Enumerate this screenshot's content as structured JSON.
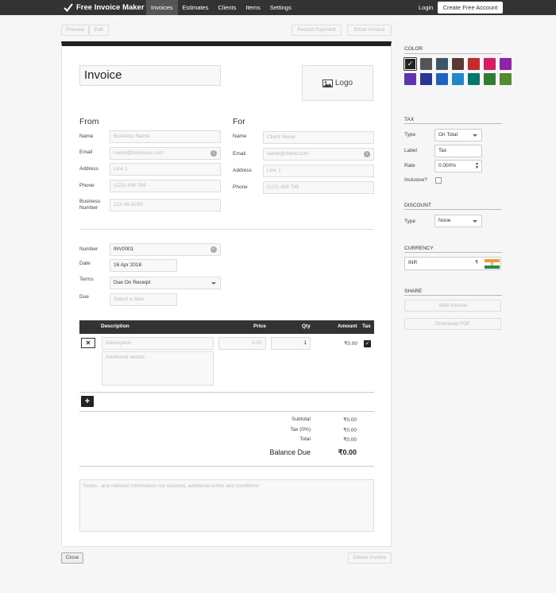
{
  "nav": {
    "brand": "Free Invoice Maker",
    "links": [
      "Invoices",
      "Estimates",
      "Clients",
      "Items",
      "Settings"
    ],
    "login": "Login",
    "create_account": "Create Free Account"
  },
  "toolbar": {
    "preview": "Preview",
    "edit": "Edit",
    "record_payment": "Record Payment",
    "email_invoice": "Email Invoice"
  },
  "invoice": {
    "title": "Invoice",
    "logo": "Logo",
    "from": {
      "heading": "From",
      "labels": {
        "name": "Name",
        "email": "Email",
        "address": "Address",
        "phone": "Phone",
        "business_number": [
          "Business",
          "Number"
        ]
      },
      "placeholders": {
        "name": "Business Name",
        "email": "name@business.com",
        "address": "Line 1",
        "phone": "(123) 456 789",
        "business_number": "123-45-6789"
      }
    },
    "for": {
      "heading": "For",
      "labels": {
        "name": "Name",
        "email": "Email",
        "address": "Address",
        "phone": "Phone"
      },
      "placeholders": {
        "name": "Client Name",
        "email": "name@client.com",
        "address": "Line 1",
        "phone": "(123) 456 789"
      }
    },
    "meta": {
      "labels": {
        "number": "Number",
        "date": "Date",
        "terms": "Terms",
        "due": "Due"
      },
      "number": "INV0001",
      "date": "16 Apr 2018",
      "terms": "Due On Receipt",
      "due_placeholder": "Select a date"
    },
    "items": {
      "headers": {
        "description": "Description",
        "price": "Price",
        "qty": "Qty",
        "amount": "Amount",
        "tax": "Tax"
      },
      "row": {
        "remove": "✕",
        "description_placeholder": "Description",
        "details_placeholder": "Additional details",
        "price_placeholder": "0.00",
        "qty": "1",
        "amount": "₹0.00",
        "taxed": true
      },
      "add": "+"
    },
    "totals": {
      "subtotal_label": "Subtotal",
      "subtotal": "₹0.00",
      "tax_label": "Tax (0%)",
      "tax": "₹0.00",
      "total_label": "Total",
      "total": "₹0.00",
      "balance_label": "Balance Due",
      "balance": "₹0.00"
    },
    "notes_placeholder": "Notes - any relevant information not covered, additional terms and conditions"
  },
  "footer": {
    "close": "Close",
    "delete": "Delete Invoice"
  },
  "sidebar": {
    "color": {
      "heading": "COLOR",
      "swatches": [
        "#222222",
        "#555555",
        "#3d5566",
        "#5a3b34",
        "#c62b2b",
        "#d81b60",
        "#8e24aa",
        "#5e35b1",
        "#283593",
        "#1e63c4",
        "#1e88c8",
        "#00796b",
        "#2e7d32",
        "#558b2f"
      ],
      "selected_index": 0
    },
    "tax": {
      "heading": "TAX",
      "type_label": "Type",
      "type": "On Total",
      "label_label": "Label",
      "label": "Tax",
      "rate_label": "Rate",
      "rate": "0.000%",
      "inclusive_label": "Inclusive?"
    },
    "discount": {
      "heading": "DISCOUNT",
      "type_label": "Type",
      "type": "None"
    },
    "currency": {
      "heading": "CURRENCY",
      "value": "INR",
      "symbol": "₹"
    },
    "share": {
      "heading": "SHARE",
      "web": "Web Invoice",
      "pdf": "Download PDF"
    }
  }
}
